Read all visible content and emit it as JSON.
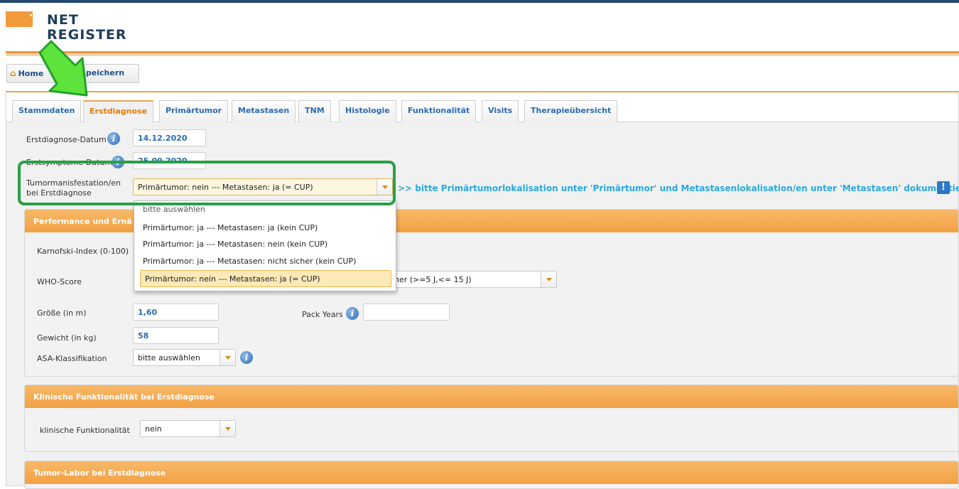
{
  "logo": {
    "line1": "NET",
    "line2": "REGISTER"
  },
  "toolbar": {
    "home_label": "Home",
    "save_label": "Speichern"
  },
  "tabs": [
    "Stammdaten",
    "Erstdiagnose",
    "Primärtumor",
    "Metastasen",
    "TNM",
    "Histologie",
    "Funktionalität",
    "Visits",
    "Therapieübersicht"
  ],
  "active_tab": "Erstdiagnose",
  "form": {
    "erstdiagnose_datum_label": "Erstdiagnose-Datum",
    "erstdiagnose_datum_value": "14.12.2020",
    "erstsymptome_datum_label": "Erstsymptome-Datum",
    "erstsymptome_datum_value": "25.09.2020",
    "tumormanifestation_label_1": "Tumormanisfestation/en",
    "tumormanifestation_label_2": "bei Erstdiagnose",
    "tumormanifestation_value": "Primärtumor: nein --- Metastasen: ja (= CUP)",
    "hint": ">> bitte Primärtumorlokalisation unter 'Primärtumor' und Metastasenlokalisation/en unter 'Metastasen' dokumentieren"
  },
  "dropdown_options": [
    "bitte auswählen",
    "Primärtumor: ja --- Metastasen: ja (kein CUP)",
    "Primärtumor: ja --- Metastasen: nein (kein CUP)",
    "Primärtumor: ja --- Metastasen: nicht sicher (kein CUP)",
    "Primärtumor: nein --- Metastasen: ja (= CUP)"
  ],
  "performance": {
    "title": "Performance und Ernä",
    "karnofski_label": "Karnofski-Index (0-100)",
    "who_label": "WHO-Score",
    "smoker_value": "her (>=5 J,<= 15 J)",
    "groesse_label": "Größe (in m)",
    "groesse_value": "1,60",
    "pack_years_label": "Pack Years",
    "gewicht_label": "Gewicht (in kg)",
    "gewicht_value": "58",
    "asa_label": "ASA-Klassifikation",
    "asa_value": "bitte auswählen"
  },
  "klinisch": {
    "title": "Klinische Funktionalität bei Erstdiagnose",
    "label": "klinische Funktionalität",
    "value": "nein"
  },
  "tumorlabor": {
    "title": "Tumor-Labor bei Erstdiagnose"
  },
  "colors": {
    "accent_orange": "#f2a043",
    "highlight_green": "#27a048",
    "link_blue": "#2aa8df",
    "navy": "#24476f"
  }
}
